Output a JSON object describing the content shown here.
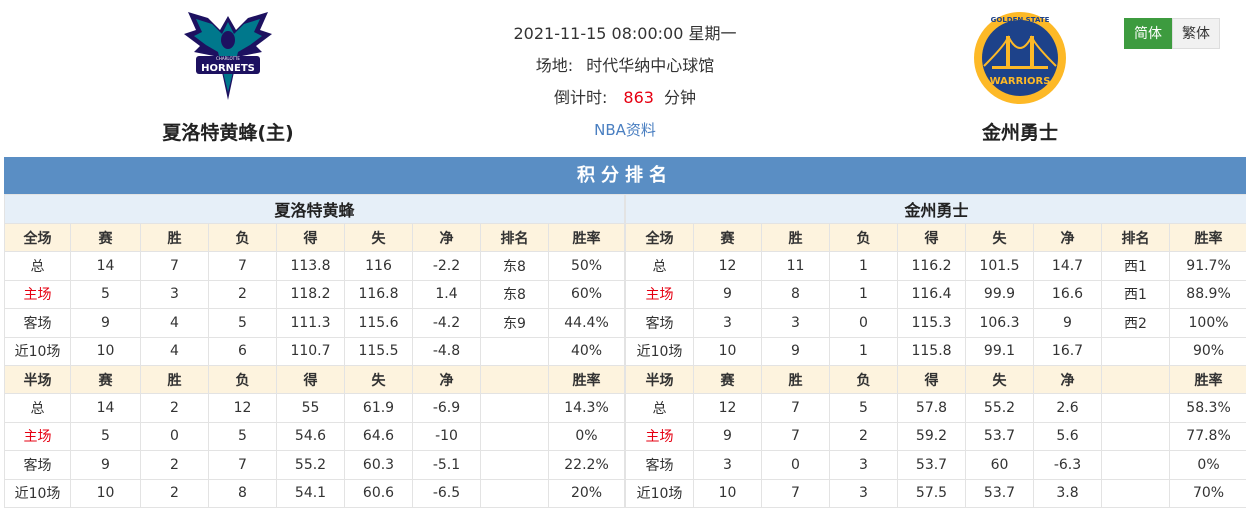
{
  "home": {
    "name": "夏洛特黄蜂(主)",
    "logo_text_top": "CHARLOTTE",
    "logo_text": "HORNETS"
  },
  "away": {
    "name": "金州勇士",
    "logo_text_top": "GOLDEN STATE",
    "logo_text": "WARRIORS"
  },
  "match": {
    "datetime": "2021-11-15 08:00:00 星期一",
    "venue_label": "场地:",
    "venue": "时代华纳中心球馆",
    "countdown_label": "倒计时:",
    "countdown_value": "863",
    "countdown_unit": "分钟",
    "link_text": "NBA资料"
  },
  "lang": {
    "simplified": "简体",
    "traditional": "繁体"
  },
  "standings": {
    "title": "积分排名",
    "home_team": "夏洛特黄蜂",
    "away_team": "金州勇士",
    "full_headers": [
      "全场",
      "赛",
      "胜",
      "负",
      "得",
      "失",
      "净",
      "排名",
      "胜率"
    ],
    "half_headers": [
      "半场",
      "赛",
      "胜",
      "负",
      "得",
      "失",
      "净",
      "",
      "胜率"
    ],
    "home_full": [
      [
        "总",
        "14",
        "7",
        "7",
        "113.8",
        "116",
        "-2.2",
        "东8",
        "50%"
      ],
      [
        "主场",
        "5",
        "3",
        "2",
        "118.2",
        "116.8",
        "1.4",
        "东8",
        "60%"
      ],
      [
        "客场",
        "9",
        "4",
        "5",
        "111.3",
        "115.6",
        "-4.2",
        "东9",
        "44.4%"
      ],
      [
        "近10场",
        "10",
        "4",
        "6",
        "110.7",
        "115.5",
        "-4.8",
        "",
        "40%"
      ]
    ],
    "home_half": [
      [
        "总",
        "14",
        "2",
        "12",
        "55",
        "61.9",
        "-6.9",
        "",
        "14.3%"
      ],
      [
        "主场",
        "5",
        "0",
        "5",
        "54.6",
        "64.6",
        "-10",
        "",
        "0%"
      ],
      [
        "客场",
        "9",
        "2",
        "7",
        "55.2",
        "60.3",
        "-5.1",
        "",
        "22.2%"
      ],
      [
        "近10场",
        "10",
        "2",
        "8",
        "54.1",
        "60.6",
        "-6.5",
        "",
        "20%"
      ]
    ],
    "away_full": [
      [
        "总",
        "12",
        "11",
        "1",
        "116.2",
        "101.5",
        "14.7",
        "西1",
        "91.7%"
      ],
      [
        "主场",
        "9",
        "8",
        "1",
        "116.4",
        "99.9",
        "16.6",
        "西1",
        "88.9%"
      ],
      [
        "客场",
        "3",
        "3",
        "0",
        "115.3",
        "106.3",
        "9",
        "西2",
        "100%"
      ],
      [
        "近10场",
        "10",
        "9",
        "1",
        "115.8",
        "99.1",
        "16.7",
        "",
        "90%"
      ]
    ],
    "away_half": [
      [
        "总",
        "12",
        "7",
        "5",
        "57.8",
        "55.2",
        "2.6",
        "",
        "58.3%"
      ],
      [
        "主场",
        "9",
        "7",
        "2",
        "59.2",
        "53.7",
        "5.6",
        "",
        "77.8%"
      ],
      [
        "客场",
        "3",
        "0",
        "3",
        "53.7",
        "60",
        "-6.3",
        "",
        "0%"
      ],
      [
        "近10场",
        "10",
        "7",
        "3",
        "57.5",
        "53.7",
        "3.8",
        "",
        "70%"
      ]
    ]
  },
  "colors": {
    "title_bar": "#5a8ec4",
    "team_head_bg": "#e6eff8",
    "col_head_bg": "#fdf3de",
    "highlight_red": "#e60012",
    "active_lang": "#3d9b3f",
    "link_blue": "#4a7fc1"
  }
}
